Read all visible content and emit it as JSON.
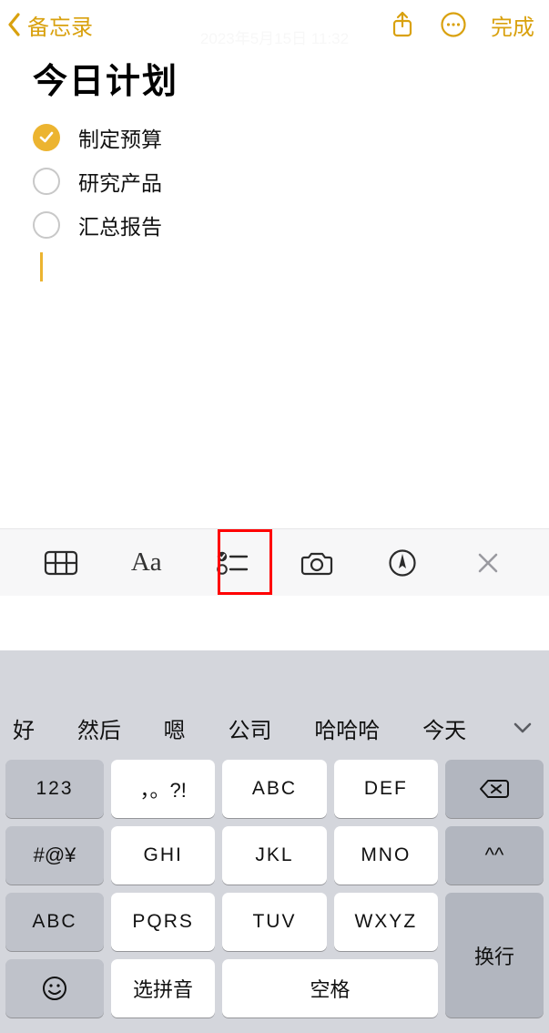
{
  "nav": {
    "back_label": "备忘录",
    "done_label": "完成"
  },
  "timestamp": "2023年5月15日 11:32",
  "note": {
    "title": "今日计划",
    "items": [
      {
        "text": "制定预算",
        "checked": true
      },
      {
        "text": "研究产品",
        "checked": false
      },
      {
        "text": "汇总报告",
        "checked": false
      }
    ]
  },
  "toolbar": {
    "text_format": "Aa"
  },
  "predictions": [
    "好",
    "然后",
    "嗯",
    "公司",
    "哈哈哈",
    "今天"
  ],
  "keys": {
    "r1": [
      "123",
      "，。?!",
      "ABC",
      "DEF"
    ],
    "r2": [
      "#@¥",
      "GHI",
      "JKL",
      "MNO",
      "^^"
    ],
    "r3": [
      "ABC",
      "PQRS",
      "TUV",
      "WXYZ"
    ],
    "r4": [
      "选拼音",
      "空格",
      "换行"
    ]
  }
}
